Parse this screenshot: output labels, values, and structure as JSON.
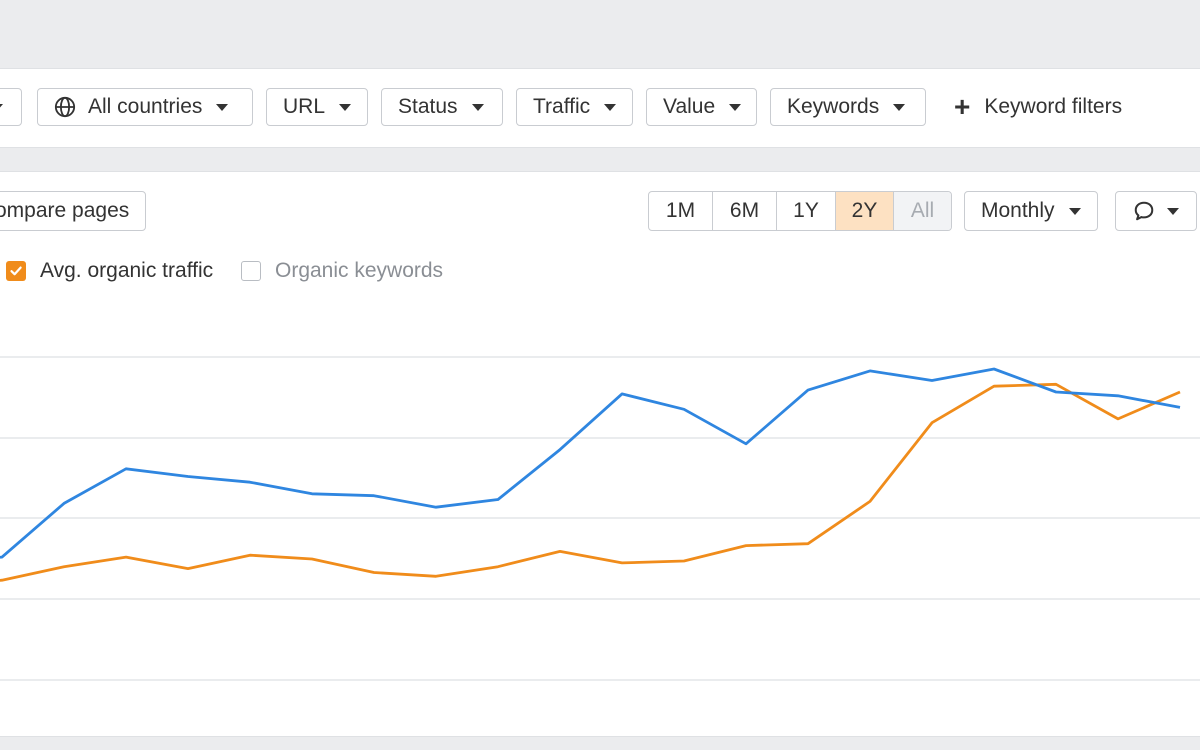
{
  "filters": {
    "countries_label": "All countries",
    "url_label": "URL",
    "status_label": "Status",
    "traffic_label": "Traffic",
    "value_label": "Value",
    "keywords_label": "Keywords",
    "keyword_filters_label": "Keyword filters"
  },
  "toolbar": {
    "compare_label": "ompare pages",
    "ranges": [
      "1M",
      "6M",
      "1Y",
      "2Y",
      "All"
    ],
    "active_range": "2Y",
    "interval_label": "Monthly"
  },
  "legend": {
    "avg_traffic": "Avg. organic traffic",
    "organic_keywords": "Organic keywords"
  },
  "colors": {
    "blue_series": "#2f86e0",
    "orange_series": "#f08c1b",
    "active_range_bg": "#fde1c2"
  },
  "chart_data": {
    "type": "line",
    "grid": true,
    "x": [
      1,
      2,
      3,
      4,
      5,
      6,
      7,
      8,
      9,
      10,
      11,
      12,
      13,
      14,
      15,
      16,
      17,
      18,
      19,
      20,
      21
    ],
    "ylim": [
      0,
      100
    ],
    "series": [
      {
        "color": "#2f86e0",
        "values": [
          31,
          32,
          46,
          55,
          53,
          51.5,
          48.5,
          48,
          45,
          47,
          60,
          74.5,
          70.5,
          61.5,
          75.5,
          80.5,
          78,
          81,
          75,
          74,
          71
        ]
      },
      {
        "color": "#f08c1b",
        "values": [
          24.5,
          26,
          29.5,
          32,
          29,
          32.5,
          31.5,
          28,
          27,
          29.5,
          33.5,
          30.5,
          31,
          35,
          35.5,
          46.5,
          67,
          76.5,
          77,
          68,
          75
        ]
      }
    ]
  }
}
